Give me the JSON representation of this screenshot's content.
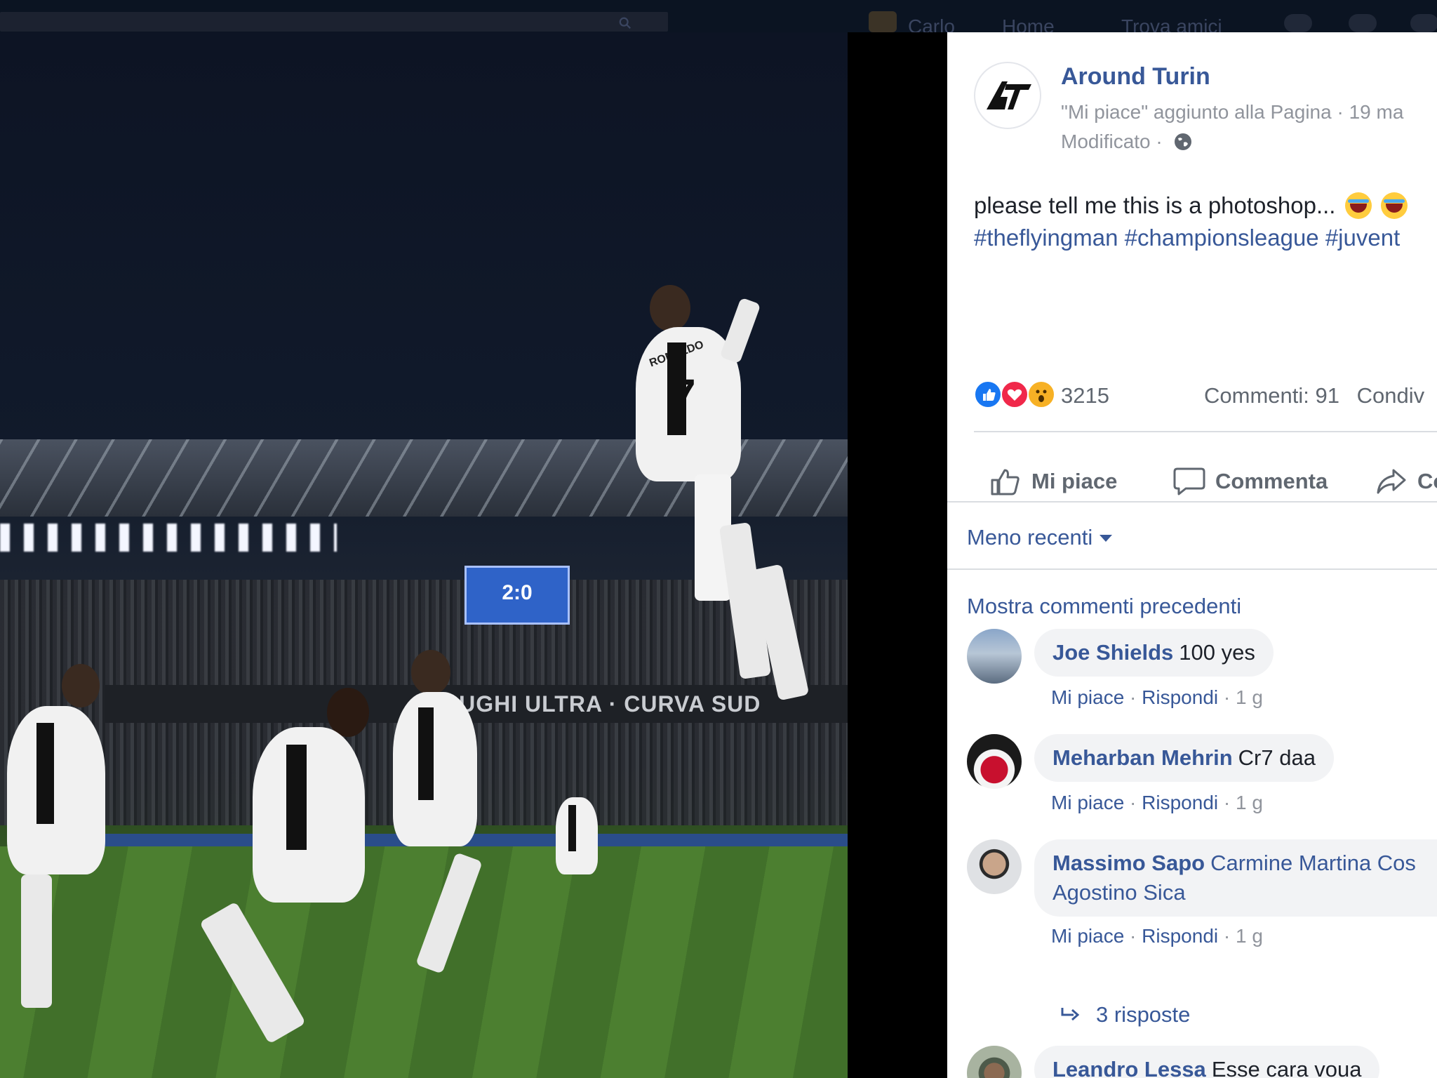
{
  "topbar": {
    "nav_items": [
      "Carlo",
      "Home",
      "Trova amici"
    ]
  },
  "photo": {
    "scoreboard_score": "2:0",
    "banner_text": "RUGHI ULTRA · CURVA SUD",
    "jersey_name": "RONALDO",
    "jersey_number": "7"
  },
  "post": {
    "page_name": "Around Turin",
    "meta_line1": "\"Mi piace\" aggiunto alla Pagina · 19 ma",
    "meta_line2": "Modificato ·",
    "text": "please tell me this is a photoshop...",
    "hashtags": "#theflyingman #championsleague #juvent",
    "reaction_count": "3215",
    "comments_count": "Commenti: 91",
    "shares": "Condiv",
    "actions": {
      "like": "Mi piace",
      "comment": "Commenta",
      "share": "Co"
    },
    "sort_label": "Meno recenti",
    "older_comments": "Mostra commenti precedenti"
  },
  "comments": [
    {
      "author": "Joe Shields",
      "text": "100 yes",
      "like": "Mi piace",
      "reply": "Rispondi",
      "time": "1 g"
    },
    {
      "author": "Meharban Mehrin",
      "text": "Cr7 daa",
      "like": "Mi piace",
      "reply": "Rispondi",
      "time": "1 g"
    },
    {
      "author": "Massimo Sapo",
      "text": "Carmine Martina Cos",
      "text_line2": "Agostino Sica",
      "like": "Mi piace",
      "reply": "Rispondi",
      "time": "1 g",
      "replies": "3 risposte"
    },
    {
      "author": "Leandro Lessa",
      "text": "Esse cara voua"
    }
  ],
  "colors": {
    "link": "#385898",
    "meta": "#90949c",
    "text": "#1d2129",
    "bubble": "#f2f3f5",
    "like": "#1877f2",
    "love": "#f0284a",
    "wow": "#f7b125"
  }
}
